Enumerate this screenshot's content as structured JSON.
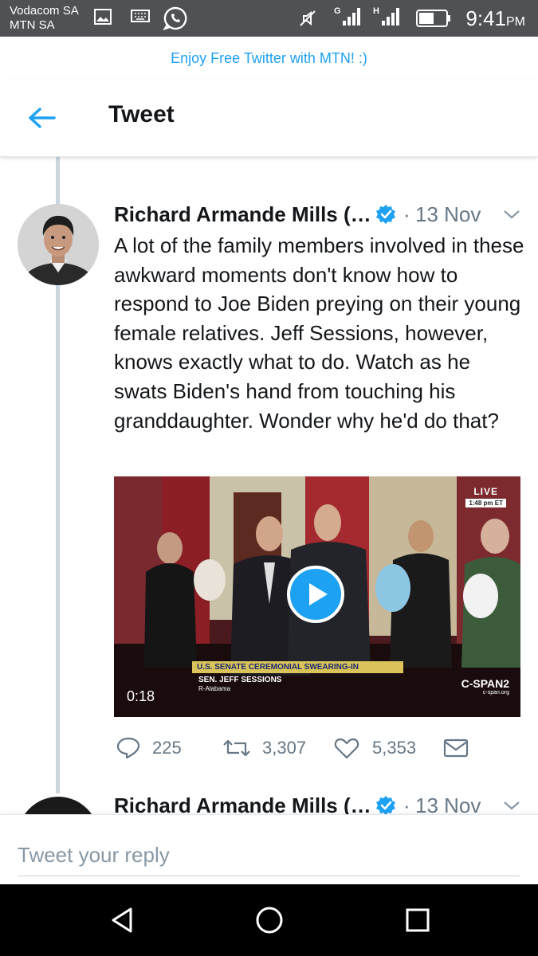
{
  "status_bar": {
    "carrier_line1": "Vodacom SA",
    "carrier_line2": "MTN SA",
    "network_1": "G",
    "network_2": "H",
    "time": "9:41",
    "ampm": "PM",
    "icons": [
      "image-icon",
      "keyboard-icon",
      "whatsapp-icon",
      "mute-icon",
      "signal-icon",
      "signal-icon",
      "battery-icon"
    ]
  },
  "promo": {
    "text": "Enjoy Free Twitter with MTN! :)"
  },
  "header": {
    "title": "Tweet",
    "back_icon": "back-arrow-icon"
  },
  "tweet": {
    "author": "Richard Armande Mills (…",
    "verified": true,
    "separator": "·",
    "date": "13 Nov",
    "text": "A lot of the family members involved in these awkward moments don't know how to respond to Joe Biden preying on their young female relatives. Jeff Sessions, however, knows exactly what to do. Watch as he swats Biden's hand from touching his granddaughter. Wonder why he'd do that?",
    "video": {
      "duration": "0:18",
      "live_label": "LIVE",
      "live_time": "1:48 pm ET",
      "banner": "U.S. SENATE CEREMONIAL SWEARING-IN",
      "name": "SEN. JEFF SESSIONS",
      "state": "R-Alabama",
      "network": "C-SPAN2",
      "network_url": "c-span.org"
    },
    "actions": {
      "replies": "225",
      "retweets": "3,307",
      "likes": "5,353"
    }
  },
  "next_tweet": {
    "author": "Richard Armande Mills (…",
    "separator": "·",
    "date": "13 Nov"
  },
  "reply": {
    "placeholder": "Tweet your reply"
  },
  "colors": {
    "accent": "#1da1f2",
    "text": "#14171a",
    "muted": "#657786",
    "status_bar": "#4f5155"
  }
}
